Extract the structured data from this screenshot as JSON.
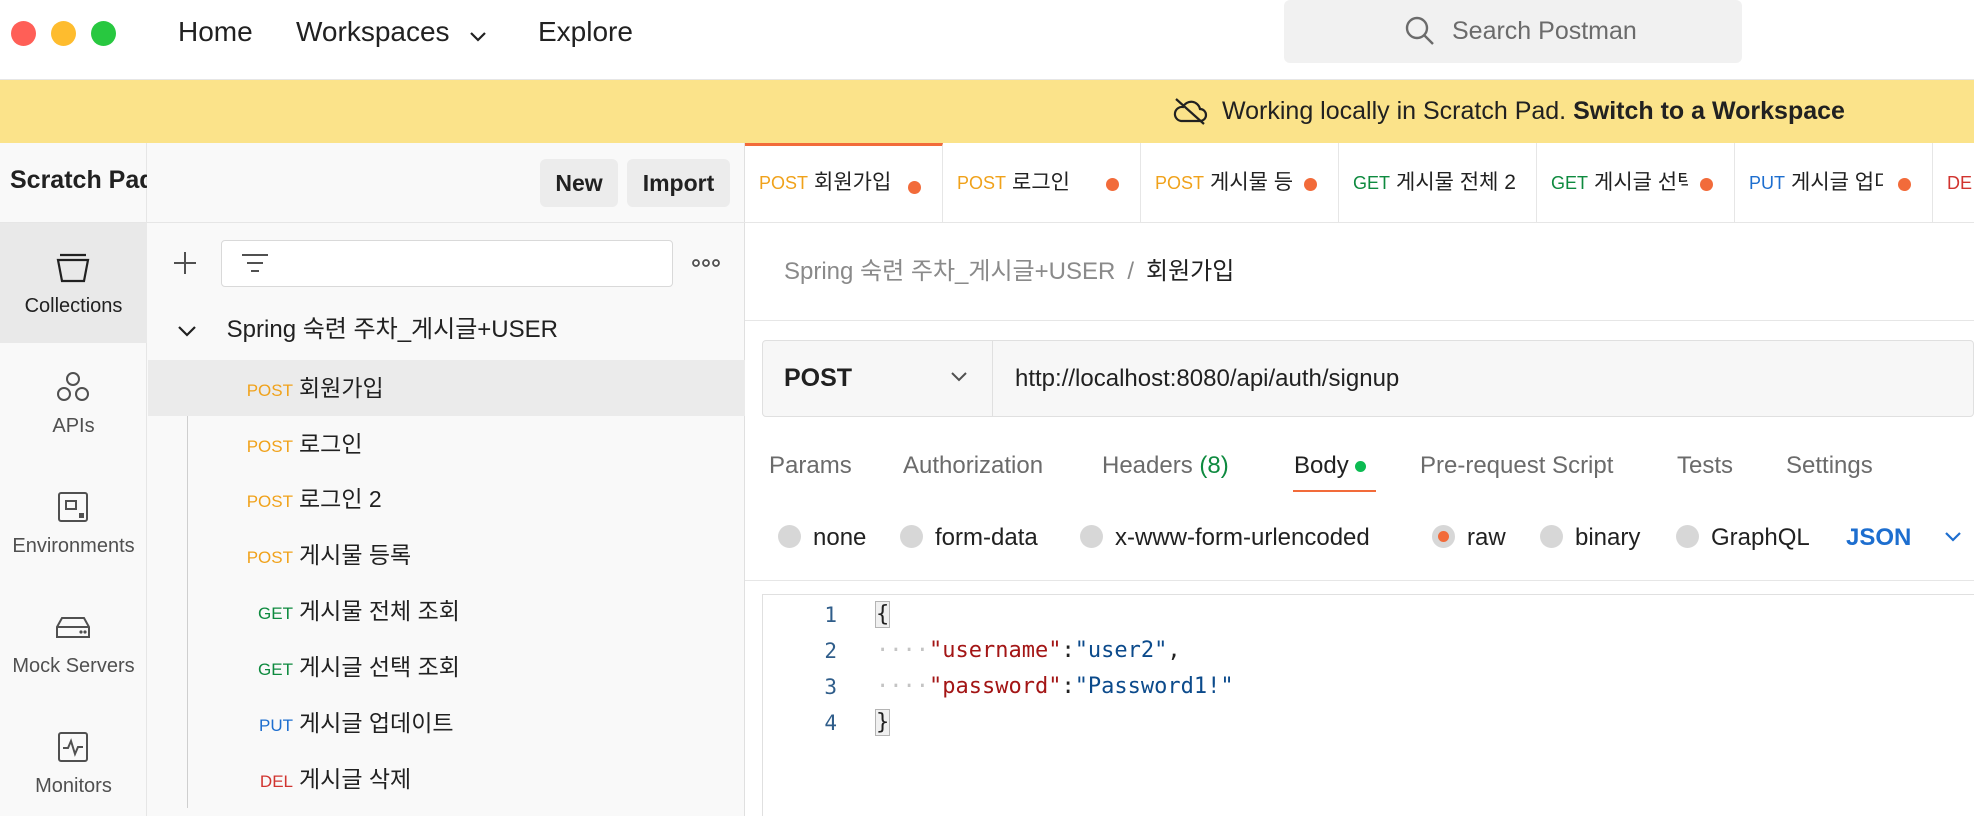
{
  "nav": {
    "home": "Home",
    "workspaces": "Workspaces",
    "explore": "Explore",
    "search_placeholder": "Search Postman"
  },
  "banner": {
    "message": "Working locally in Scratch Pad.",
    "link": "Switch to a Workspace"
  },
  "sidebar": {
    "title": "Scratch Pad",
    "new_label": "New",
    "import_label": "Import",
    "rail": [
      {
        "label": "Collections",
        "icon": "collections-icon"
      },
      {
        "label": "APIs",
        "icon": "apis-icon"
      },
      {
        "label": "Environments",
        "icon": "environments-icon"
      },
      {
        "label": "Mock Servers",
        "icon": "mock-servers-icon"
      },
      {
        "label": "Monitors",
        "icon": "monitors-icon"
      }
    ],
    "collection_name": "Spring 숙련 주차_게시글+USER",
    "requests": [
      {
        "method": "POST",
        "name": "회원가입"
      },
      {
        "method": "POST",
        "name": "로그인"
      },
      {
        "method": "POST",
        "name": "로그인 2"
      },
      {
        "method": "POST",
        "name": "게시물 등록"
      },
      {
        "method": "GET",
        "name": "게시물 전체 조회"
      },
      {
        "method": "GET",
        "name": "게시글 선택 조회"
      },
      {
        "method": "PUT",
        "name": "게시글 업데이트"
      },
      {
        "method": "DEL",
        "name": "게시글 삭제"
      }
    ]
  },
  "tabs": [
    {
      "method": "POST",
      "name": "회원가입"
    },
    {
      "method": "POST",
      "name": "로그인"
    },
    {
      "method": "POST",
      "name": "게시물 등"
    },
    {
      "method": "GET",
      "name": "게시물 전체 2"
    },
    {
      "method": "GET",
      "name": "게시글 선택"
    },
    {
      "method": "PUT",
      "name": "게시글 업다"
    },
    {
      "method": "DE",
      "name": ""
    }
  ],
  "breadcrumb": {
    "collection": "Spring 숙련 주차_게시글+USER",
    "separator": "/",
    "current": "회원가입"
  },
  "request": {
    "method": "POST",
    "url": "http://localhost:8080/api/auth/signup"
  },
  "request_tabs": {
    "params": "Params",
    "authorization": "Authorization",
    "headers": "Headers",
    "headers_count": "(8)",
    "body": "Body",
    "pre_request": "Pre-request Script",
    "tests": "Tests",
    "settings": "Settings"
  },
  "body_types": {
    "none": "none",
    "form_data": "form-data",
    "urlencoded": "x-www-form-urlencoded",
    "raw": "raw",
    "binary": "binary",
    "graphql": "GraphQL",
    "selected": "raw",
    "format": "JSON"
  },
  "editor": {
    "line_numbers": [
      "1",
      "2",
      "3",
      "4"
    ],
    "open_brace": "{",
    "close_brace": "}",
    "indent": "····",
    "key1": "\"username\"",
    "val1": "\"user2\"",
    "key2": "\"password\"",
    "val2": "\"Password1!\"",
    "colon": ":",
    "comma": ","
  },
  "colors": {
    "accent": "#f26b3a",
    "post": "#f0a21b",
    "get": "#0e8a3f",
    "put": "#1d6ecf",
    "del": "#d1342f",
    "banner": "#fbe38a"
  }
}
